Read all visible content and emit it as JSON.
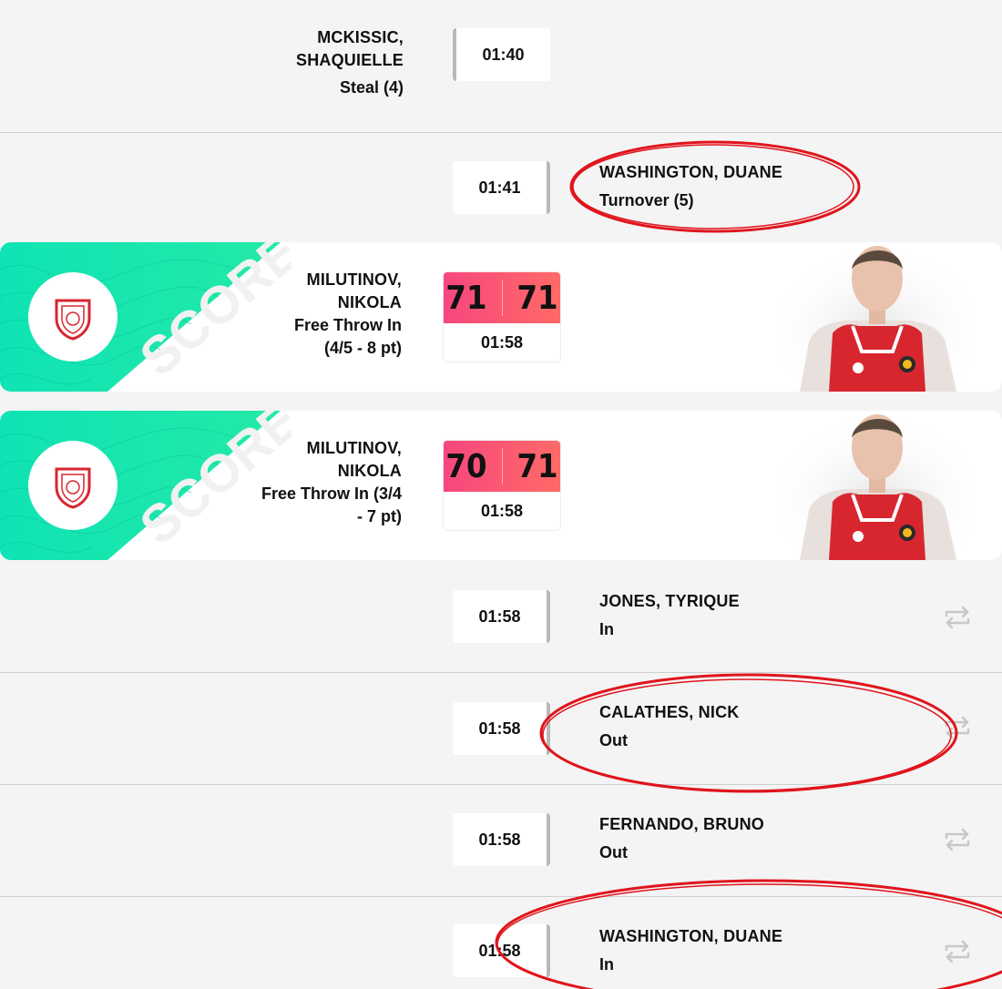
{
  "events": [
    {
      "time": "01:40",
      "player": [
        "MCKISSIC,",
        "SHAQUIELLE"
      ],
      "event": "Steal (4)"
    },
    {
      "time": "01:41",
      "player": [
        "WASHINGTON, DUANE"
      ],
      "event": "Turnover (5)"
    },
    {
      "time": "01:58",
      "player": [
        "JONES, TYRIQUE"
      ],
      "event": "In"
    },
    {
      "time": "01:58",
      "player": [
        "CALATHES, NICK"
      ],
      "event": "Out"
    },
    {
      "time": "01:58",
      "player": [
        "FERNANDO, BRUNO"
      ],
      "event": "Out"
    },
    {
      "time": "01:58",
      "player": [
        "WASHINGTON, DUANE"
      ],
      "event": "In"
    }
  ],
  "score_cards": [
    {
      "label": "SCORE",
      "player": [
        "MILUTINOV,",
        "NIKOLA"
      ],
      "event": [
        "Free Throw In",
        "(4/5 - 8 pt)"
      ],
      "score_home": "71",
      "score_away": "71",
      "time": "01:58"
    },
    {
      "label": "SCORE",
      "player": [
        "MILUTINOV,",
        "NIKOLA"
      ],
      "event": [
        "Free Throw In (3/4",
        "- 7 pt)"
      ],
      "score_home": "70",
      "score_away": "71",
      "time": "01:58"
    }
  ],
  "icons": {
    "substitution": "swap-arrows-icon",
    "team_logo": "olympiacos-logo",
    "player_photo": "player-photo"
  },
  "colors": {
    "score_gradient_start": "#f6477e",
    "score_gradient_end": "#ff6a67",
    "score_banner": "#12e0b0",
    "annotation": "#e0141c",
    "jersey_red": "#d8262f"
  }
}
